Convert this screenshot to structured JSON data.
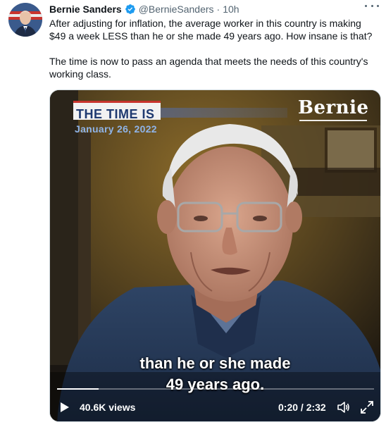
{
  "tweet": {
    "display_name": "Bernie Sanders",
    "handle": "@BernieSanders",
    "separator": "·",
    "timestamp": "10h",
    "paragraphs": [
      "After adjusting for inflation, the average worker in this country is making $49 a week LESS than he or she made 49 years ago. How insane is that?",
      "The time is now to pass an agenda that meets the needs of this country's working class."
    ],
    "icons": {
      "verified": "verified-badge-icon",
      "more": "more-options-icon"
    },
    "colors": {
      "verified": "#1d9bf0",
      "secondary_text": "#536471"
    }
  },
  "video": {
    "banner_text": "THE TIME IS",
    "date_text": "January 26, 2022",
    "logo_text": "Bernie",
    "caption_lines": [
      "than he or she made",
      "49 years ago."
    ],
    "views": "40.6K views",
    "time_display": "0:20 / 2:32",
    "progress": 0.131,
    "controls": {
      "play": "play-icon",
      "volume": "volume-icon",
      "fullscreen": "fullscreen-icon"
    }
  }
}
